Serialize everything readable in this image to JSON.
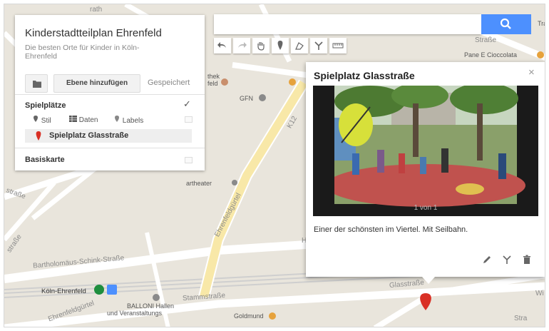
{
  "map": {
    "labels": {
      "tra": "Tra",
      "strasse_tr": "Straße",
      "pane": "Pane E Cioccolata",
      "thek": "thek",
      "feld": "feld",
      "gfn": "GFN",
      "k12": "K12",
      "artheater": "artheater",
      "ehrenfeldguertel": "Ehrenfeldgürtel",
      "strasse_left": "straße",
      "strasse_left2": "straße",
      "bartholomaeus": "Bartholomäus-Schink-Straße",
      "koeln_ehrenfeld": "Köln-Ehrenfeld",
      "stammstrasse": "Stammstraße",
      "ehrenfeldguertel_b": "Ehrenfeldgürtel",
      "balloni1": "BALLONI Hallen",
      "balloni2": "und Veranstaltungs",
      "goldmund": "Goldmund",
      "glasstrasse": "Glasstraße",
      "wi": "Wi",
      "ra": "ra",
      "stra": "Stra",
      "ra_top": "rath",
      "hs": "H"
    }
  },
  "panel": {
    "title": "Kinderstadtteilplan Ehrenfeld",
    "subtitle": "Die besten Orte für Kinder in Köln-Ehrenfeld",
    "add_layer": "Ebene hinzufügen",
    "saved": "Gespeichert",
    "layer_name": "Spielplätze",
    "style": "Stil",
    "data": "Daten",
    "labels": "Labels",
    "place": "Spielplatz Glasstraße",
    "base_map": "Basiskarte"
  },
  "card": {
    "title": "Spielplatz Glasstraße",
    "close": "×",
    "photo_count": "1 von 1",
    "description": "Einer der schönsten im Viertel. Mit Seilbahn."
  },
  "colors": {
    "accent": "#4d90fe",
    "marker": "#d93025",
    "map_bg": "#e9e5dc"
  }
}
